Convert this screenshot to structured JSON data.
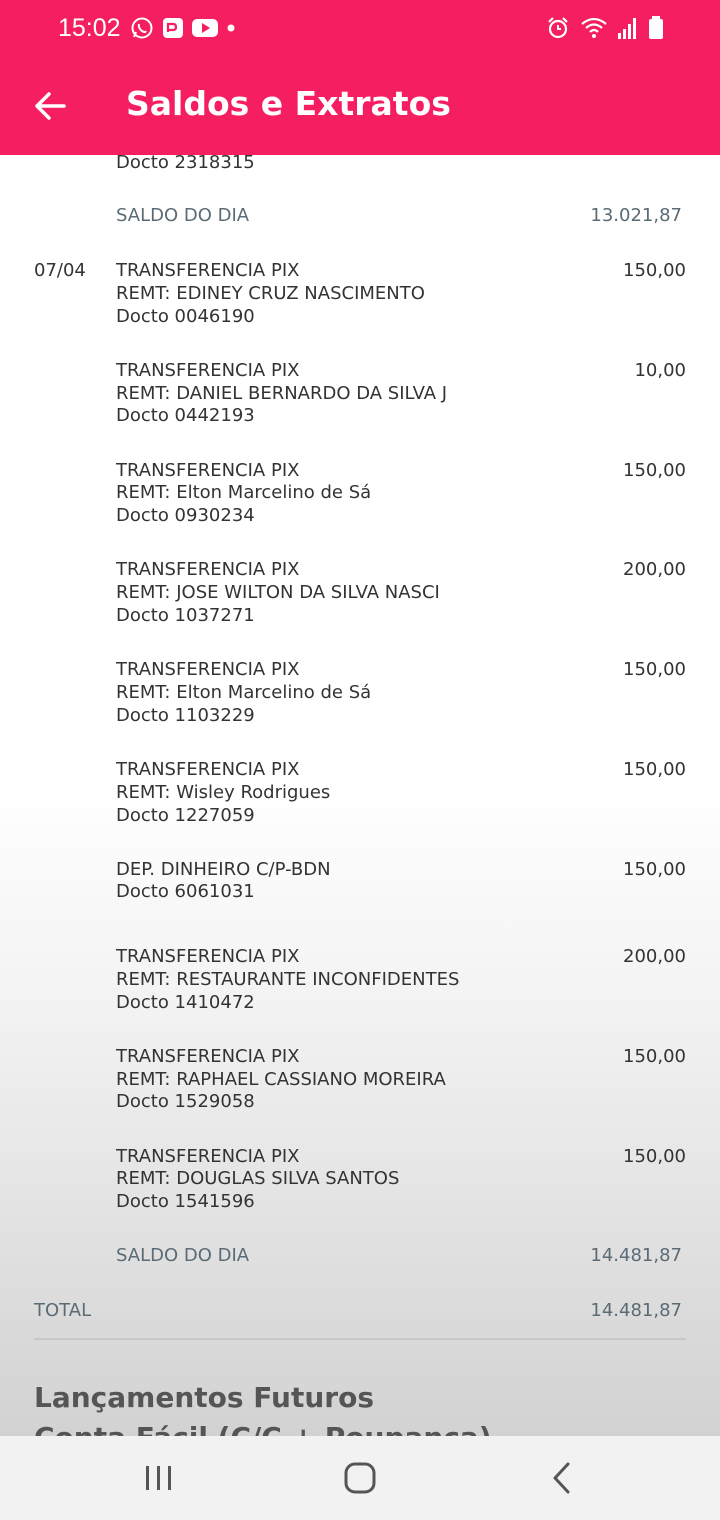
{
  "status": {
    "time": "15:02"
  },
  "appbar": {
    "title": "Saldos e Extratos"
  },
  "statement": {
    "top_docto": "Docto 2318315",
    "saldo1": {
      "label": "SALDO DO DIA",
      "value": "13.021,87"
    },
    "date": "07/04",
    "items": [
      {
        "l1": "TRANSFERENCIA PIX",
        "l2": "REMT: EDINEY CRUZ NASCIMENTO",
        "l3": "Docto 0046190",
        "amount": "150,00"
      },
      {
        "l1": "TRANSFERENCIA PIX",
        "l2": "REMT: DANIEL BERNARDO DA SILVA J",
        "l3": "Docto 0442193",
        "amount": "10,00"
      },
      {
        "l1": "TRANSFERENCIA PIX",
        "l2": "REMT: Elton Marcelino de Sá",
        "l3": "Docto 0930234",
        "amount": "150,00"
      },
      {
        "l1": "TRANSFERENCIA PIX",
        "l2": "REMT: JOSE WILTON DA SILVA NASCI",
        "l3": "Docto 1037271",
        "amount": "200,00"
      },
      {
        "l1": "TRANSFERENCIA PIX",
        "l2": "REMT: Elton Marcelino de Sá",
        "l3": "Docto 1103229",
        "amount": "150,00"
      },
      {
        "l1": "TRANSFERENCIA PIX",
        "l2": "REMT: Wisley Rodrigues",
        "l3": "Docto 1227059",
        "amount": "150,00"
      },
      {
        "l1": "DEP. DINHEIRO C/P-BDN",
        "l2": "Docto 6061031",
        "l3": "",
        "amount": "150,00"
      },
      {
        "l1": "TRANSFERENCIA PIX",
        "l2": "REMT: RESTAURANTE INCONFIDENTES",
        "l3": "Docto 1410472",
        "amount": "200,00"
      },
      {
        "l1": "TRANSFERENCIA PIX",
        "l2": "REMT: RAPHAEL CASSIANO MOREIRA",
        "l3": "Docto 1529058",
        "amount": "150,00"
      },
      {
        "l1": "TRANSFERENCIA PIX",
        "l2": "REMT: DOUGLAS SILVA SANTOS",
        "l3": "Docto 1541596",
        "amount": "150,00"
      }
    ],
    "saldo2": {
      "label": "SALDO DO DIA",
      "value": "14.481,87"
    },
    "total": {
      "label": "TOTAL",
      "value": "14.481,87"
    }
  },
  "futuros": {
    "title": "Lançamentos Futuros",
    "subtitle": "Conta Fácil (C/C + Poupança)"
  }
}
